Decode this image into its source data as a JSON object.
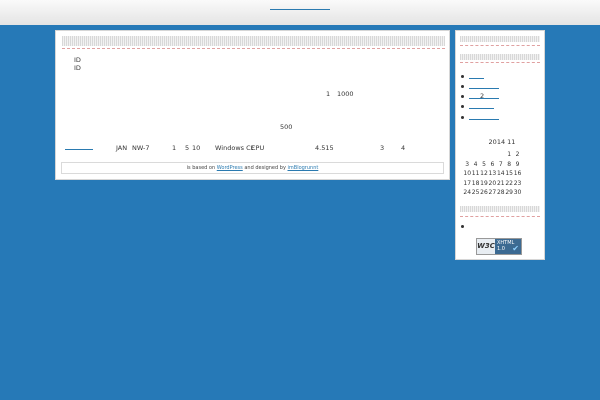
{
  "main": {
    "id_lines": [
      "ID",
      "ID"
    ],
    "numbers_line": {
      "one": "1",
      "thousand": "1000"
    },
    "five_hundred": "500",
    "info_row": [
      "JAN",
      "NW-7",
      "1",
      "5",
      "10",
      "Windows CE",
      "CPU",
      "4.515",
      "3",
      "4"
    ],
    "footer": {
      "text_before": "is based on",
      "link1": "WordPress",
      "text_mid": "and designed by",
      "link2": "imBlogrunnt"
    }
  },
  "sidebar": {
    "link_list_third": "2",
    "calendar": {
      "title": "2014 11",
      "rows": [
        [
          "",
          "",
          "",
          "",
          "",
          "1",
          "2"
        ],
        [
          "3",
          "4",
          "5",
          "6",
          "7",
          "8",
          "9"
        ],
        [
          "10",
          "11",
          "12",
          "13",
          "14",
          "15",
          "16"
        ],
        [
          "17",
          "18",
          "19",
          "20",
          "21",
          "22",
          "23"
        ],
        [
          "24",
          "25",
          "26",
          "27",
          "28",
          "29",
          "30"
        ]
      ]
    },
    "badge": {
      "w3c": "W3C",
      "line1": "XHTML",
      "line2": "1.0",
      "check": "✔"
    }
  }
}
